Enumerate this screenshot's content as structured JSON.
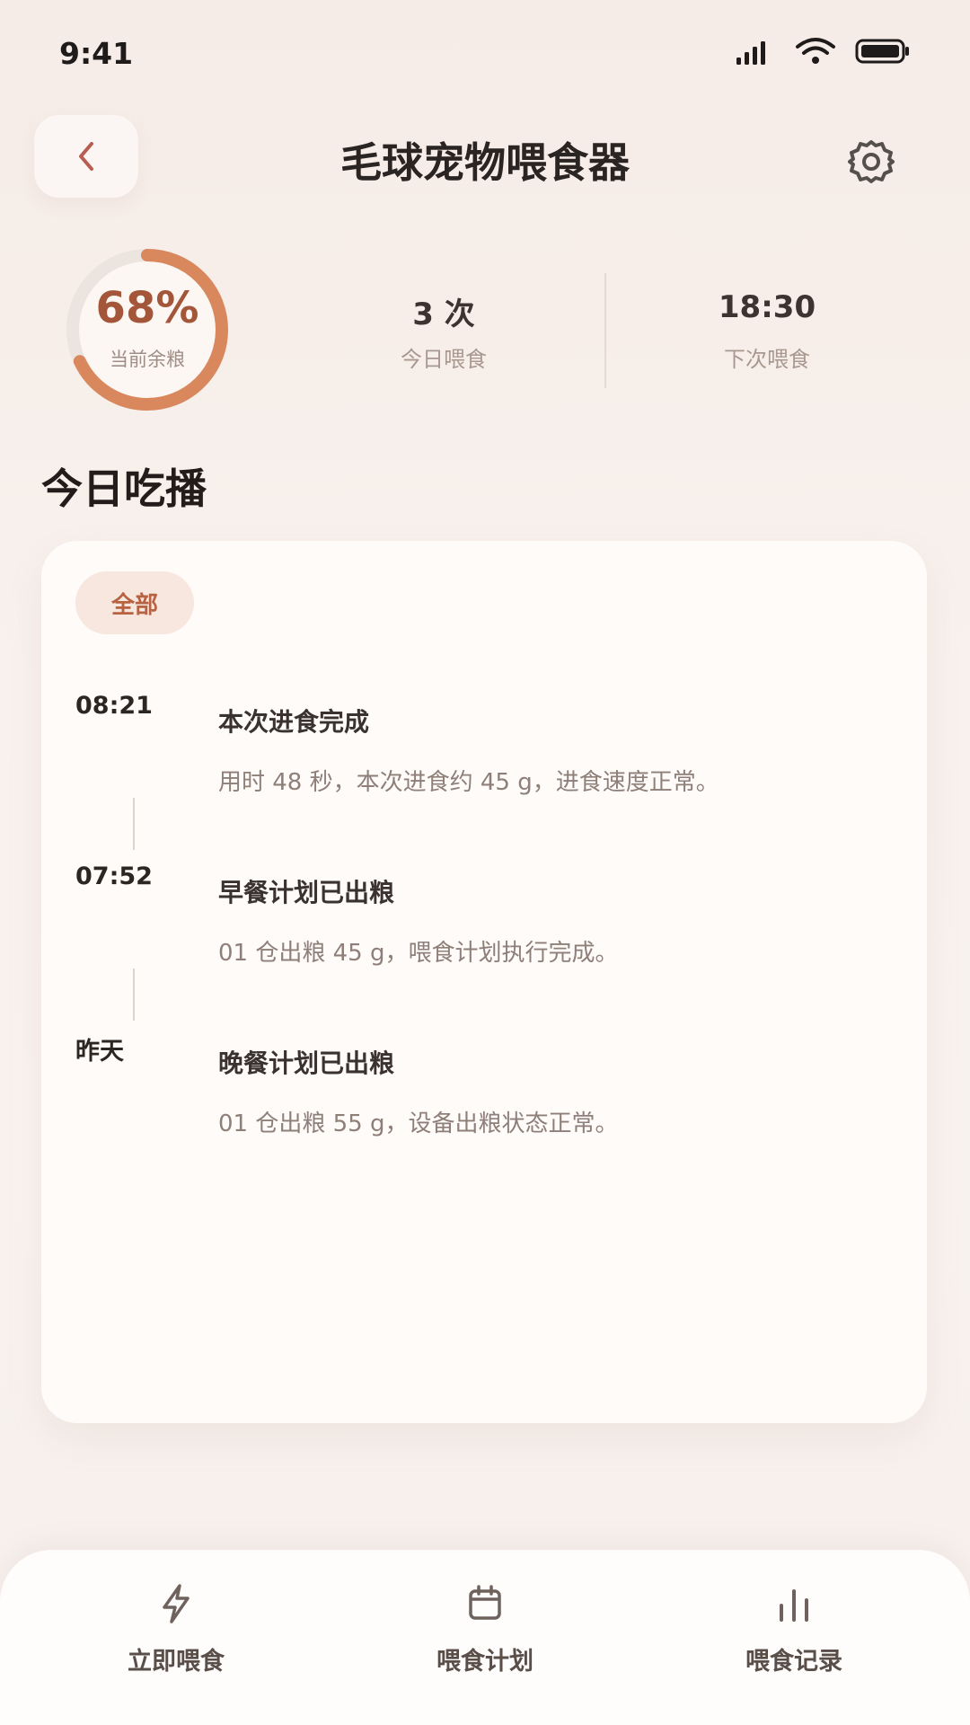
{
  "status_bar": {
    "time": "9:41",
    "icons": [
      "signal-icon",
      "wifi-icon",
      "battery-icon"
    ]
  },
  "header": {
    "title": "毛球宠物喂食器",
    "back_icon": "chevron-left-icon",
    "settings_icon": "gear-icon"
  },
  "stats": {
    "remaining_food": {
      "value": "68%",
      "label": "当前余粮",
      "fraction": 0.68
    },
    "feedings_today": {
      "value": "3 次",
      "label": "今日喂食"
    },
    "next_feeding": {
      "value": "18:30",
      "label": "下次喂食"
    }
  },
  "section_title": "今日吃播",
  "filter": {
    "label": "全部"
  },
  "timeline": [
    {
      "time": "08:21",
      "title": "本次进食完成",
      "description": "用时 48 秒，本次进食约 45 g，进食速度正常。"
    },
    {
      "time": "07:52",
      "title": "早餐计划已出粮",
      "description": "01 仓出粮 45 g，喂食计划执行完成。"
    },
    {
      "time": "昨天",
      "title": "晚餐计划已出粮",
      "description": "01 仓出粮 55 g，设备出粮状态正常。"
    }
  ],
  "bottom_nav": [
    {
      "label": "立即喂食",
      "icon": "lightning-icon"
    },
    {
      "label": "喂食计划",
      "icon": "calendar-icon"
    },
    {
      "label": "喂食记录",
      "icon": "bar-chart-icon"
    }
  ],
  "colors": {
    "accent": "#d9875d",
    "accent_dark": "#a4563a",
    "chip_bg": "#f7e7de",
    "background": "#f7efea",
    "card": "#fefbf9"
  }
}
